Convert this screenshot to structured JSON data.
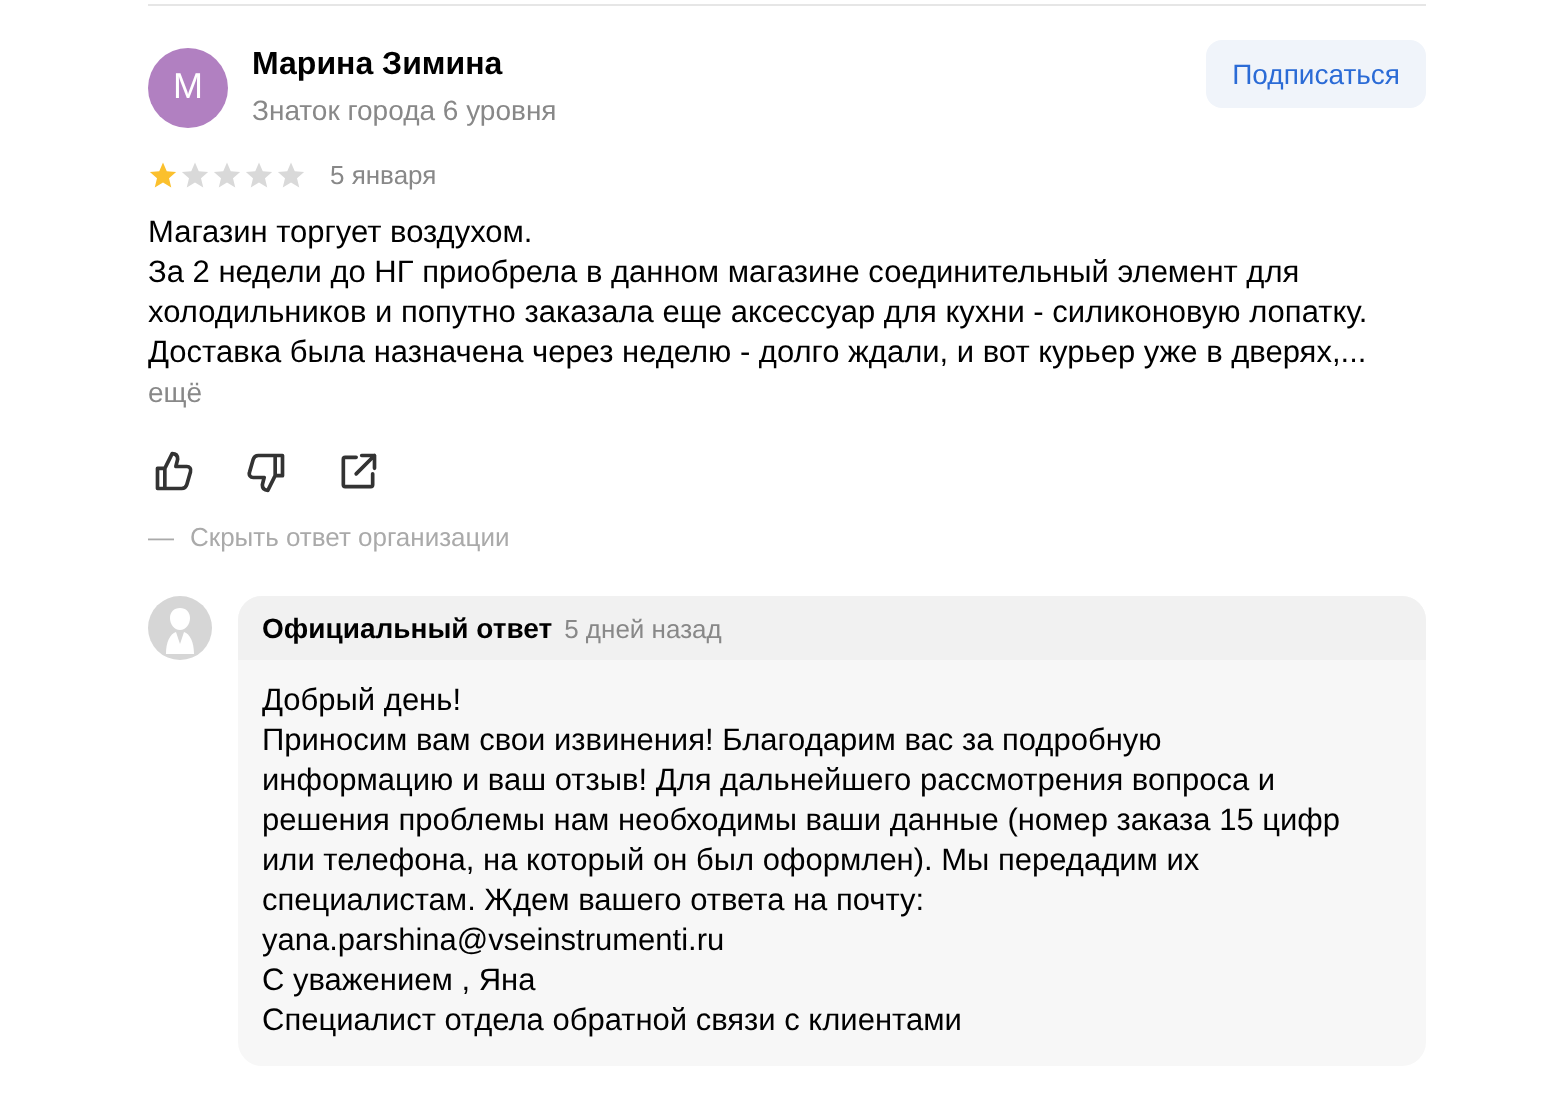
{
  "review": {
    "author": {
      "initial": "М",
      "name": "Марина Зимина",
      "status": "Знаток города 6 уровня",
      "color": "#b180c1"
    },
    "subscribe_button": "Подписаться",
    "stars": 1,
    "date": "5 января",
    "lines": [
      "Магазин торгует воздухом.",
      "За 2 недели до НГ приобрела в данном магазине соединительный элемент для",
      "холодильников и попутно заказала еще аксессуар для кухни - силиконовую лопатку.",
      "Доставка была назначена через неделю - долго ждали, и вот курьер уже в дверях,..."
    ],
    "more_link": "ещё",
    "hide_reply_dash": "—",
    "hide_reply_link": "Скрыть ответ организации"
  },
  "official_reply": {
    "title": "Официальный ответ",
    "time": "5 дней назад",
    "lines": [
      "Добрый день!",
      "Приносим вам свои извинения! Благодарим вас за подробную",
      "информацию и ваш отзыв! Для дальнейшего рассмотрения вопроса и",
      "решения проблемы нам необходимы ваши данные (номер заказа 15 цифр",
      "или телефона, на который он был оформлен). Мы передадим их",
      "специалистам. Ждем вашего ответа на почту:",
      "yana.parshina@vseinstrumenti.ru",
      "С уважением , Яна",
      "Специалист отдела обратной связи с клиентами"
    ]
  }
}
